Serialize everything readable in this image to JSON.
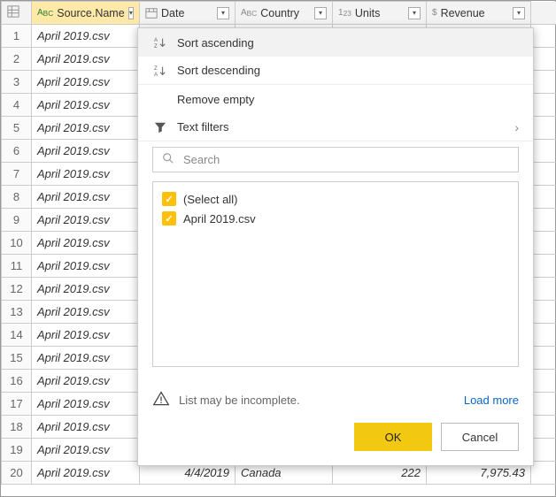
{
  "columns": {
    "source": "Source.Name",
    "date": "Date",
    "country": "Country",
    "units": "Units",
    "revenue": "Revenue"
  },
  "rows_count": 20,
  "row_value": "April 2019.csv",
  "visible_row": {
    "date": "4/4/2019",
    "country": "Canada",
    "units": "222",
    "revenue": "7,975.43"
  },
  "menu": {
    "sort_asc": "Sort ascending",
    "sort_desc": "Sort descending",
    "remove_empty": "Remove empty",
    "text_filters": "Text filters",
    "search_placeholder": "Search",
    "select_all": "(Select all)",
    "item0": "April 2019.csv",
    "warn": "List may be incomplete.",
    "load_more": "Load more",
    "ok": "OK",
    "cancel": "Cancel"
  }
}
